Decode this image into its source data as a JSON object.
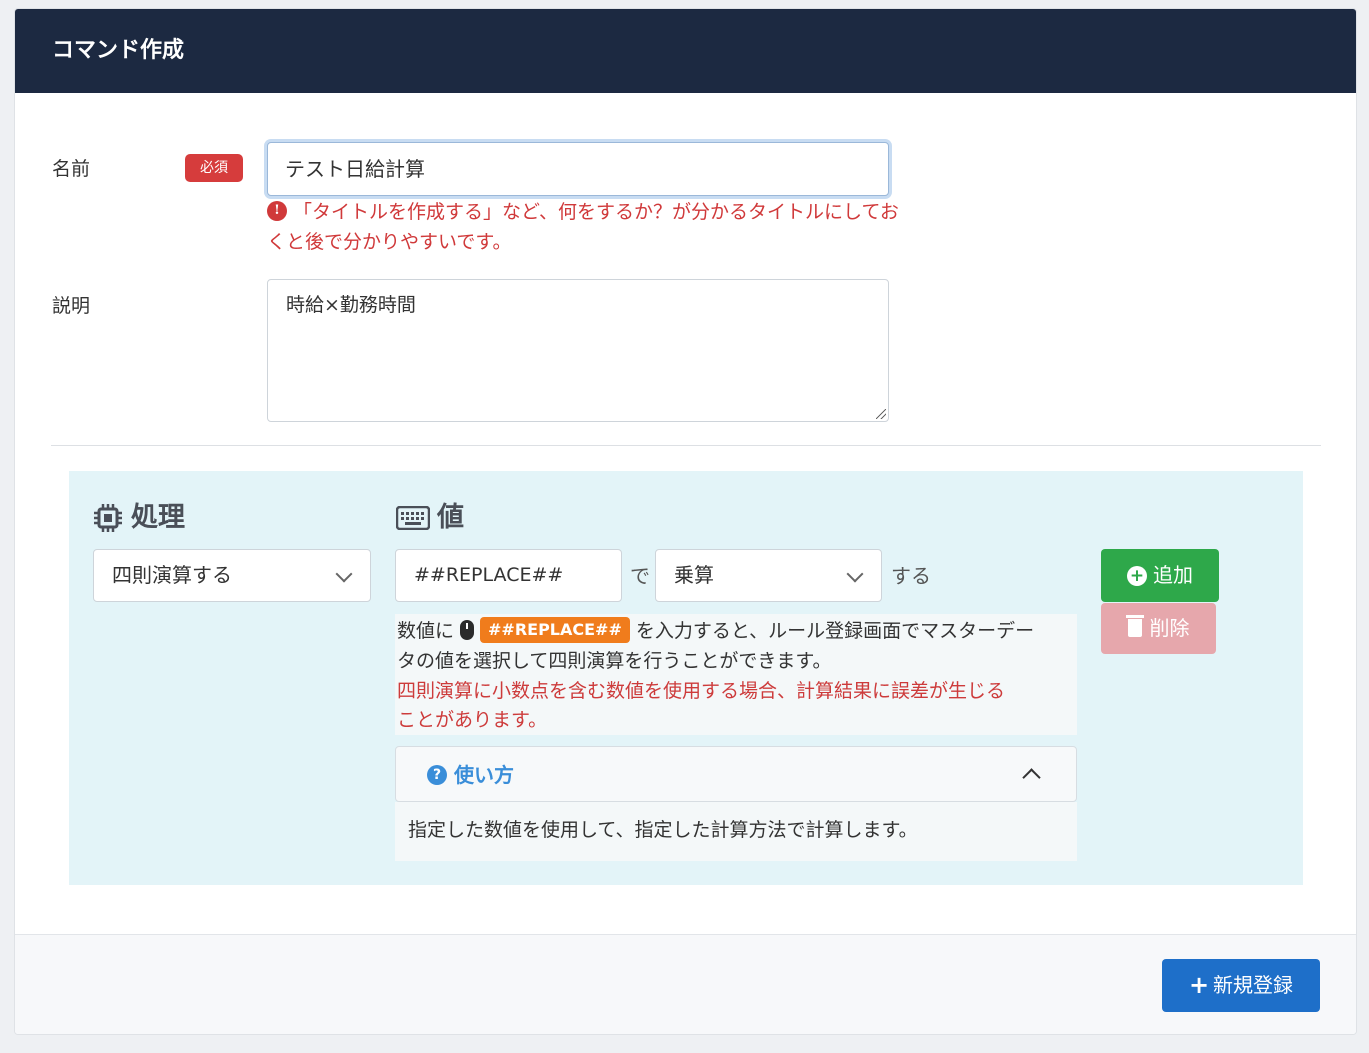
{
  "header": {
    "title": "コマンド作成"
  },
  "form": {
    "name_label": "名前",
    "required_badge": "必須",
    "name_value": "テスト日給計算",
    "name_error": "「タイトルを作成する」など、何をするか？が分かるタイトルにしておくと後で分かりやすいです。",
    "description_label": "説明",
    "description_value": "時給×勤務時間"
  },
  "process": {
    "process_heading": "処理",
    "value_heading": "値",
    "process_select": "四則演算する",
    "value_input": "##REPLACE##",
    "de_text": "で",
    "operation_select": "乗算",
    "suru_text": "する",
    "add_button": "追加",
    "delete_button": "削除",
    "help_prefix": "数値に",
    "help_tag": "##REPLACE##",
    "help_line1_suffix": "を入力すると、ルール登録画面でマスターデー",
    "help_line2": "タの値を選択して四則演算を行うことができます。",
    "help_warning_1": "四則演算に小数点を含む数値を使用する場合、計算結果に誤差が生じる",
    "help_warning_2": "ことがあります。",
    "howto_title": "使い方",
    "howto_body": "指定した数値を使用して、指定した計算方法で計算します。"
  },
  "footer": {
    "submit_button": "新規登録"
  },
  "icons": {
    "error": "exclamation-circle-icon",
    "process": "cpu-chip-icon",
    "value": "keyboard-icon",
    "add": "plus-circle-icon",
    "delete": "trash-icon",
    "mouse": "mouse-icon",
    "help": "question-circle-icon",
    "collapse": "chevron-up-icon",
    "submit": "plus-icon"
  },
  "colors": {
    "header_bg": "#1c2941",
    "required": "#d63c3c",
    "error_text": "#d0393a",
    "panel_bg": "#e3f4f8",
    "add_button": "#2ea84a",
    "delete_button": "#e6a7ac",
    "tag": "#f07c1c",
    "help_accent": "#3a8ed9",
    "submit_button": "#1e6fc9"
  }
}
